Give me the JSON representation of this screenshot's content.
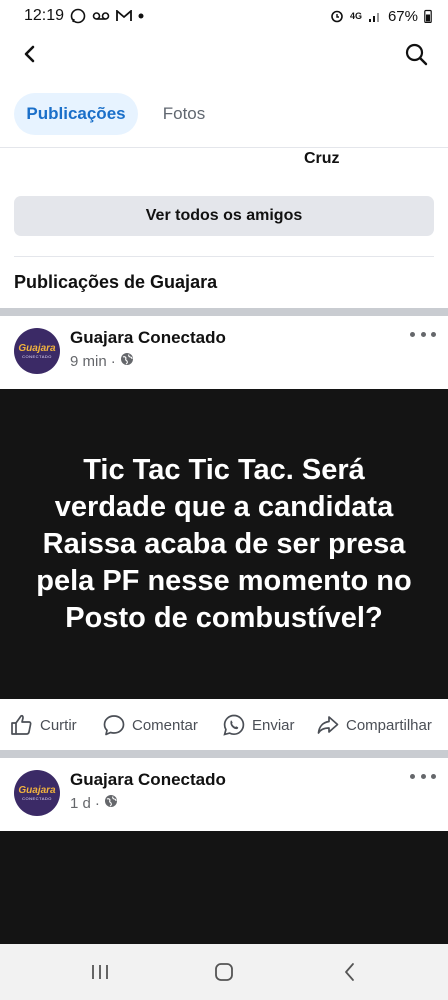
{
  "status_bar": {
    "time": "12:19",
    "network_label": "4G",
    "battery": "67%"
  },
  "tabs": [
    {
      "label": "Publicações",
      "active": true
    },
    {
      "label": "Fotos",
      "active": false
    }
  ],
  "friends": {
    "visible_name_fragment": "Cruz",
    "see_all_label": "Ver todos os amigos"
  },
  "section_title": "Publicações de Guajara",
  "posts": [
    {
      "author": "Guajara Conectado",
      "avatar_text_main": "Guajara",
      "avatar_text_sub": "CONECTADO",
      "time": "9 min",
      "separator": "·",
      "visibility_icon": "globe-icon",
      "image_text": "Tic Tac Tic Tac. Será verdade que a candidata Raissa acaba de ser presa pela PF nesse momento no Posto de combustível?"
    },
    {
      "author": "Guajara Conectado",
      "avatar_text_main": "Guajara",
      "avatar_text_sub": "CONECTADO",
      "time": "1 d",
      "separator": "·",
      "visibility_icon": "globe-icon"
    }
  ],
  "actions": {
    "like": "Curtir",
    "comment": "Comentar",
    "send": "Enviar",
    "share": "Compartilhar"
  },
  "colors": {
    "accent": "#1a6fc9",
    "tab_active_bg": "#e7f3ff",
    "post_image_bg": "#141414",
    "avatar_bg": "#3b2a66"
  }
}
